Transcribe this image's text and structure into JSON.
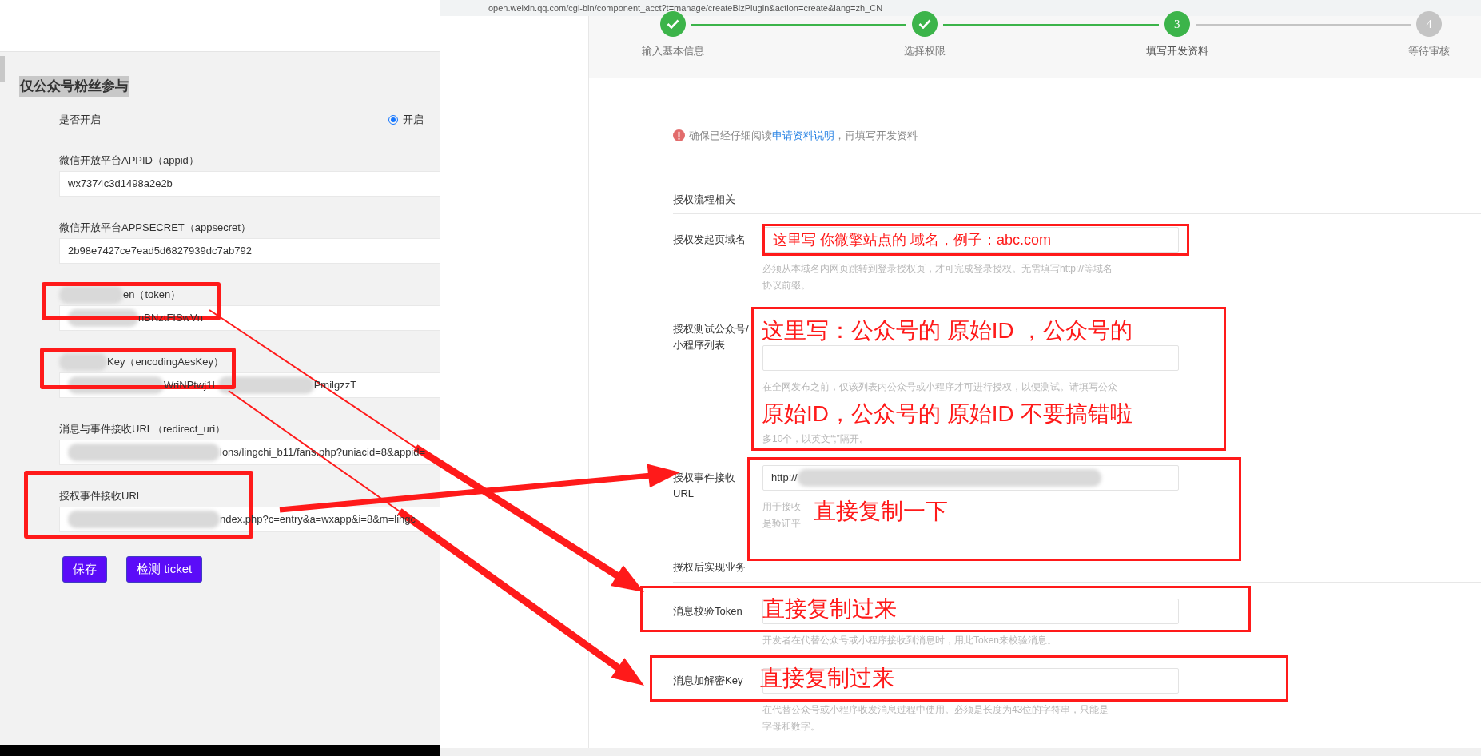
{
  "left_panel": {
    "section_title": "仅公众号粉丝参与",
    "toggle": {
      "label": "是否开启",
      "option": "开启",
      "selected": true
    },
    "fields": [
      {
        "label": [
          {
            "kind": "text",
            "text": "微信开放平台APPID（appid）"
          }
        ],
        "value": [
          {
            "kind": "text",
            "text": "wx7374c3d1498a2e2b"
          }
        ],
        "highlighted": false
      },
      {
        "label": [
          {
            "kind": "text",
            "text": "微信开放平台APPSECRET（appsecret）"
          }
        ],
        "value": [
          {
            "kind": "text",
            "text": "2b98e7427ce7ead5d6827939dc7ab792"
          }
        ],
        "highlighted": false
      },
      {
        "label": [
          {
            "kind": "blur"
          },
          {
            "kind": "text",
            "text": "en（token）"
          }
        ],
        "value": [
          {
            "kind": "blur"
          },
          {
            "kind": "text",
            "text": "nBNztFISwVn"
          }
        ],
        "highlighted": true
      },
      {
        "label": [
          {
            "kind": "blur"
          },
          {
            "kind": "text",
            "text": "Key（encodingAesKey）"
          }
        ],
        "value": [
          {
            "kind": "blur"
          },
          {
            "kind": "text",
            "text": "WriNPtwj1L"
          },
          {
            "kind": "blur"
          },
          {
            "kind": "text",
            "text": "PmilgzzT"
          }
        ],
        "highlighted": true
      },
      {
        "label": [
          {
            "kind": "text",
            "text": "消息与事件接收URL（redirect_uri）"
          }
        ],
        "value": [
          {
            "kind": "blur"
          },
          {
            "kind": "text",
            "text": "lons/lingchi_b11/fans.php?uniacid=8&appid="
          }
        ],
        "highlighted": false
      },
      {
        "label": [
          {
            "kind": "text",
            "text": "授权事件接收URL"
          }
        ],
        "value": [
          {
            "kind": "blur"
          },
          {
            "kind": "text",
            "text": "ndex.php?c=entry&a=wxapp&i=8&m=lingc"
          }
        ],
        "highlighted": true
      }
    ],
    "buttons": [
      "保存",
      "检测 ticket"
    ]
  },
  "right_panel": {
    "address": "open.weixin.qq.com/cgi-bin/component_acct?t=manage/createBizPlugin&action=create&lang=zh_CN",
    "steps": [
      {
        "label": "输入基本信息",
        "completed": true,
        "current": false
      },
      {
        "label": "选择权限",
        "completed": true,
        "current": false
      },
      {
        "label": "填写开发资料",
        "completed": false,
        "current": true,
        "number": "3"
      },
      {
        "label": "等待审核",
        "completed": false,
        "current": false,
        "number": "4"
      }
    ],
    "notice": {
      "before": "确保已经仔细阅读",
      "link": "申请资料说明",
      "after": "，再填写开发资料"
    },
    "sections": [
      {
        "title": "授权流程相关",
        "fields": [
          {
            "label": "授权发起页域名",
            "help": [
              "必须从本域名内网页跳转到登录授权页，才可完成登录授权。无需填写http://等域名",
              "协议前缀。"
            ],
            "annotation": [
              "这里写 你微擎站点的 域名，例子：abc.com"
            ],
            "large_note": false
          },
          {
            "label": "授权测试公众号/小程序列表",
            "help": [
              "在全网发布之前，仅该列表内公众号或小程序才可进行授权，以便测试。请填写公众",
              "多10个，以英文“;”隔开。"
            ],
            "annotation": [
              "这里写：公众号的 原始ID ，公众号的",
              "原始ID，公众号的 原始ID  不要搞错啦"
            ],
            "large_note": true
          },
          {
            "label": "授权事件接收URL",
            "value": [
              {
                "kind": "text",
                "text": "http://"
              },
              {
                "kind": "blur"
              }
            ],
            "help": [
              "用于接收",
              "是验证平"
            ],
            "annotation": [
              "直接复制一下"
            ],
            "large_note": true
          }
        ]
      },
      {
        "title": "授权后实现业务",
        "fields": [
          {
            "label": "消息校验Token",
            "help": [
              "开发者在代替公众号或小程序接收到消息时，用此Token来校验消息。"
            ],
            "annotation": [
              "直接复制过来"
            ],
            "large_note": true
          },
          {
            "label": "消息加解密Key",
            "help": [
              "在代替公众号或小程序收发消息过程中使用。必须是长度为43位的字符串，只能是",
              "字母和数字。"
            ],
            "annotation": [
              "直接复制过来"
            ],
            "large_note": true
          }
        ]
      }
    ]
  }
}
